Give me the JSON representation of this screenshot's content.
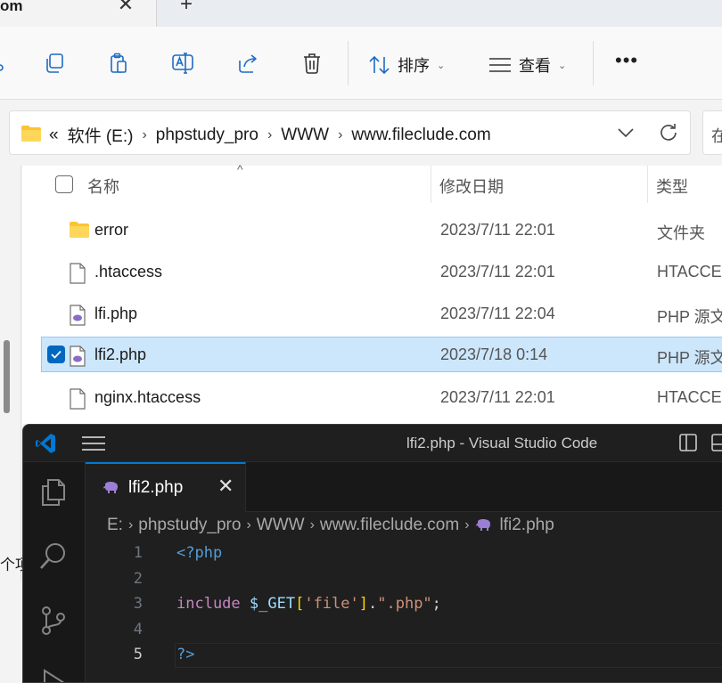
{
  "explorer": {
    "tab": {
      "title": "om",
      "close_glyph": "✕",
      "new_tab_glyph": "+"
    },
    "toolbar": {
      "icons": [
        "cut-icon",
        "copy-icon",
        "paste-icon",
        "rename-icon",
        "share-icon",
        "delete-icon"
      ],
      "sort_label": "排序",
      "view_label": "查看",
      "more_label": "•••"
    },
    "address": {
      "crumb_overflow": "«",
      "crumbs": [
        "软件 (E:)",
        "phpstudy_pro",
        "WWW",
        "www.fileclude.com"
      ],
      "separator": "›"
    },
    "search_stub": "在",
    "nav_label": "个项目",
    "columns": {
      "name": "名称",
      "date": "修改日期",
      "type": "类型"
    },
    "files": [
      {
        "name": "error",
        "date": "2023/7/11 22:01",
        "type": "文件夹",
        "icon": "folder-icon",
        "selected": false
      },
      {
        "name": ".htaccess",
        "date": "2023/7/11 22:01",
        "type": "HTACCESS",
        "icon": "file-icon",
        "selected": false
      },
      {
        "name": "lfi.php",
        "date": "2023/7/11 22:04",
        "type": "PHP 源文",
        "icon": "php-file-icon",
        "selected": false
      },
      {
        "name": "lfi2.php",
        "date": "2023/7/18 0:14",
        "type": "PHP 源文",
        "icon": "php-file-icon",
        "selected": true
      },
      {
        "name": "nginx.htaccess",
        "date": "2023/7/11 22:01",
        "type": "HTACCESS",
        "icon": "file-icon",
        "selected": false
      }
    ]
  },
  "vscode": {
    "window_title": "lfi2.php - Visual Studio Code",
    "tab": {
      "label": "lfi2.php",
      "close_glyph": "✕"
    },
    "breadcrumb": [
      "E:",
      "phpstudy_pro",
      "WWW",
      "www.fileclude.com",
      "lfi2.php"
    ],
    "breadcrumb_sep": "›",
    "line_numbers": [
      "1",
      "2",
      "3",
      "4",
      "5"
    ],
    "code": {
      "line1": "<?php",
      "line3_kw": "include",
      "line3_var": " $_GET",
      "line3_br_open": "[",
      "line3_key": "'file'",
      "line3_br_close": "]",
      "line3_dot": ".",
      "line3_str": "\".php\"",
      "line3_semi": ";",
      "line5": "?>"
    },
    "colors": {
      "accent": "#0078d4",
      "background": "#1f1f1f",
      "keyword": "#569cd6",
      "string": "#ce9178"
    }
  }
}
